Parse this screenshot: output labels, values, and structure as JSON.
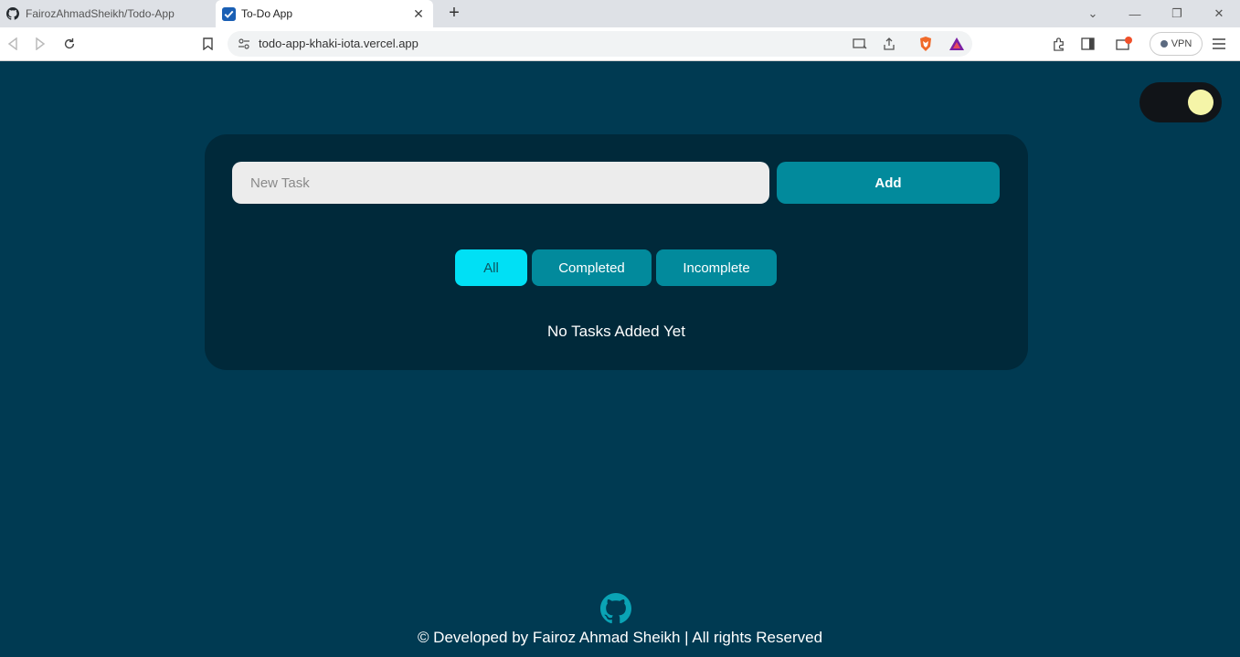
{
  "browser": {
    "tabs": [
      {
        "title": "FairozAhmadSheikh/Todo-App",
        "icon": "github-icon",
        "active": false
      },
      {
        "title": "To-Do App",
        "icon": "checkbox-icon",
        "active": true
      }
    ],
    "url": "todo-app-khaki-iota.vercel.app",
    "vpn_label": "VPN"
  },
  "app": {
    "task_input_placeholder": "New Task",
    "task_input_value": "",
    "add_label": "Add",
    "filters": [
      {
        "label": "All",
        "active": true
      },
      {
        "label": "Completed",
        "active": false
      },
      {
        "label": "Incomplete",
        "active": false
      }
    ],
    "empty_message": "No Tasks Added Yet",
    "theme_toggle": {
      "state": "dark"
    }
  },
  "footer": {
    "icon": "github-icon",
    "text": "© Developed by Fairoz Ahmad Sheikh | All rights Reserved"
  },
  "colors": {
    "page_bg": "#003a52",
    "card_bg": "#00293a",
    "accent": "#028a9c",
    "active_filter": "#00e0f5",
    "toggle_knob": "#f5f5a8"
  }
}
